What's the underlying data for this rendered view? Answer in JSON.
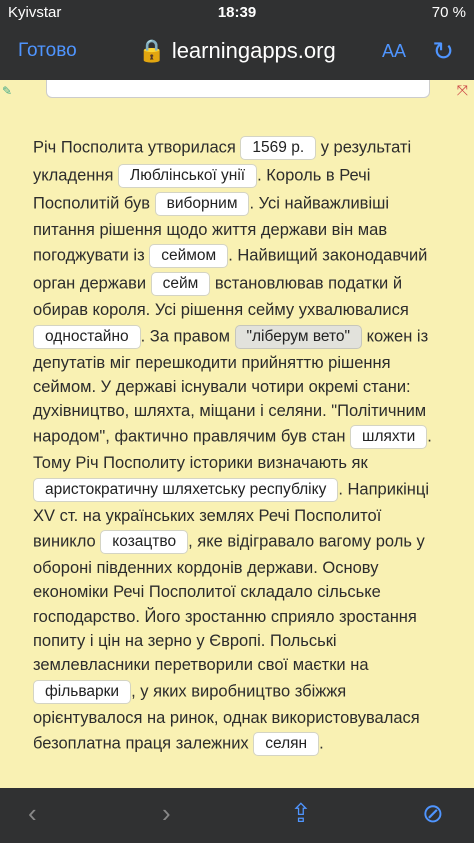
{
  "status": {
    "carrier": "Kyivstar",
    "time": "18:39",
    "battery": "70 %"
  },
  "browser": {
    "done": "Готово",
    "url": "learningapps.org",
    "text_size": "AA"
  },
  "colors": {
    "accent": "#4f95ff",
    "background": "#f9f1b3",
    "fab": "#3b7be0"
  },
  "icons": {
    "lock": "lock-icon",
    "reload": "reload-icon",
    "back": "chevron-left-icon",
    "forward": "chevron-right-icon",
    "share": "share-icon",
    "compass": "compass-icon",
    "check": "check-icon"
  },
  "paragraph": {
    "t1": "Річ Посполита утворилася ",
    "a1": "1569 р.",
    "t2": " у результаті укладення ",
    "a2": "Люблінської унії",
    "t3": ". Король в Речі Посполитій був ",
    "a3": "виборним",
    "t4": ". Усі найважливіші питання рішення щодо життя держави він мав погоджувати із ",
    "a4": "сеймом",
    "t5": ". Найвищий законодавчий орган держави ",
    "a5": "сейм",
    "t6": " встановлював податки й обирав короля. Усі рішення сейму ухвалювалися ",
    "a6": "одностайно",
    "t7": ". За правом ",
    "a7": "\"ліберум вето\"",
    "t8": " кожен із депутатів міг перешкодити прийняттю рішення сеймом. У державі існували чотири окремі стани: духівництво, шляхта, міщани і селяни. \"Політичним народом\", фактично правлячим був стан ",
    "a8": "шляхти",
    "t9": ". Тому Річ Посполиту історики визначають як ",
    "a9": "аристократичну шляхетську республіку",
    "t10": ". Наприкінці XV ст. на українських землях Речі Посполитої виникло ",
    "a10": "козацтво",
    "t11": ", яке відігравало вагому роль у обороні південних кордонів держави. Основу економіки Речі Посполитої складало сільське господарство. Його зростанню сприяло зростання попиту і цін на зерно у Європі. Польські землевласники перетворили свої маєтки на ",
    "a11": "фільварки",
    "t12": ", у яких виробництво збіжжя орієнтувалося на ринок, однак використовувалася безоплатна праця залежних ",
    "a12": "селян",
    "t13": "."
  }
}
